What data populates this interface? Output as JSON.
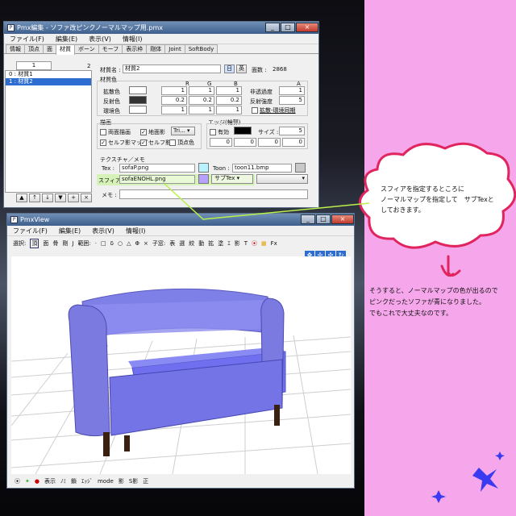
{
  "editor": {
    "title": "Pmx編集 - ソファ改ピンクノーマルマップ用.pmx",
    "menus": [
      "ファイル(F)",
      "編集(E)",
      "表示(V)",
      "情報(I)"
    ],
    "tabs": [
      "情報",
      "頂点",
      "面",
      "材質",
      "ボーン",
      "モーフ",
      "表示枠",
      "剛体",
      "Joint",
      "SoftBody"
    ],
    "active_tab": "材質",
    "list_count_top": "1",
    "list_count_right": "2",
    "list_items": [
      "0 : 材質1",
      "1 : 材質2"
    ],
    "material_name_label": "材質名 :",
    "material_name": "材質2",
    "lang_jp": "日",
    "lang_en": "英",
    "face_count_label": "面数 :",
    "face_count": "2868",
    "color_section": "材質色",
    "col_r": "R",
    "col_g": "G",
    "col_b": "B",
    "col_a": "A",
    "diffuse_label": "拡散色",
    "diffuse": [
      "1",
      "1",
      "1"
    ],
    "specular_label": "反射色",
    "specular": [
      "0.2",
      "0.2",
      "0.2"
    ],
    "ambient_label": "環境色",
    "ambient": [
      "1",
      "1",
      "1"
    ],
    "transparency_label": "非透過度",
    "transparency": "1",
    "reflect_label": "反射強度",
    "reflect": "5",
    "sync_label": "拡散-環境同期",
    "draw_section": "描画",
    "double_sided": "両面描画",
    "ground_shadow": "地面影",
    "tri_label": "Tri...",
    "self_shadow_map": "セルフ影マップ",
    "self_shadow": "セルフ影",
    "vertex_color": "頂点色",
    "edge_section": "エッジ(輪郭)",
    "edge_enable": "有効",
    "edge_size_label": "サイズ :",
    "edge_size": "5",
    "edge_color": [
      "0",
      "0",
      "0",
      "0"
    ],
    "texture_section": "テクスチャ／メモ",
    "tex_label": "Tex :",
    "tex_value": "sofaP.png",
    "toon_label": "Toon :",
    "toon_value": "toon11.bmp",
    "sphere_label": "スフィア :",
    "sphere_value": "sofaENOHL.png",
    "sphere_mode": "サブTex",
    "memo_label": "メモ :",
    "list_buttons": [
      "▲",
      "↑",
      "↓",
      "▼",
      "+",
      "×"
    ]
  },
  "viewer": {
    "title": "PmxView",
    "menus": [
      "ファイル(F)",
      "編集(E)",
      "表示(V)",
      "情報(I)"
    ],
    "toolbar_select": "選択:",
    "toolbar_select_items": [
      "頂",
      "面",
      "骨",
      "剛",
      "J"
    ],
    "toolbar_range": "範囲:",
    "toolbar_child": "子窓:",
    "toolbar_child_items": [
      "表",
      "選",
      "絞",
      "動",
      "拡",
      "塗",
      "ｴ",
      "影",
      "T"
    ],
    "toolbar_fx": "Fx",
    "status_items": [
      "表示",
      "ﾉﾐ",
      "鎖",
      "ｴｯｼﾞ",
      "mode",
      "影",
      "S影",
      "正"
    ],
    "status_mode": "mode"
  },
  "callout": {
    "lines": [
      "スフィアを指定するところに",
      "ノーマルマップを指定して　サブTexと",
      "しておきます。"
    ]
  },
  "caption": {
    "lines": [
      "そうすると、ノーマルマップの色が出るので",
      "ピンクだったソファが青になりました。",
      "でもこれで大丈夫なのです。"
    ]
  },
  "colors": {
    "pink_bg": "#f6a6ea",
    "sofa_blue": "#7f7fe8",
    "highlight_green": "#d6f2b8",
    "callout_border": "#e0245e",
    "star_blue": "#3a3af0"
  }
}
